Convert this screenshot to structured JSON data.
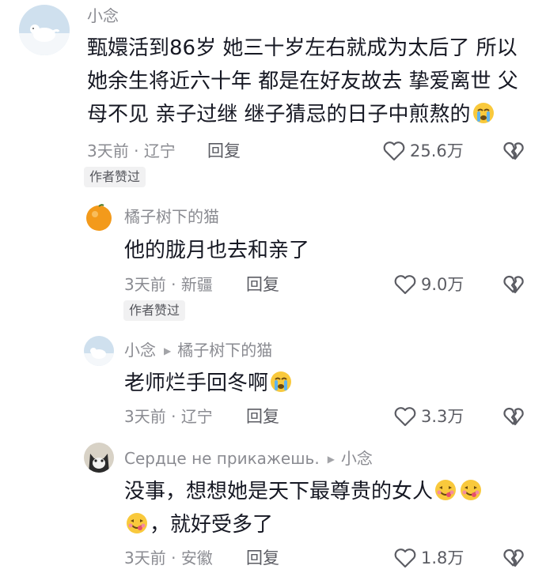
{
  "comments": [
    {
      "author": "小念",
      "reply_to": "",
      "lines": [
        "甄嬛活到86岁 她三十岁左右就成为太后了 所以",
        "她余生将近六十年 都是在好友故去 挚爱离世 父",
        "母不见 亲子过继 继子猜忌的日子中煎熬的"
      ],
      "time": "3天前",
      "location": "辽宁",
      "reply_label": "回复",
      "likes": "25.6万",
      "badge": "作者赞过",
      "avatar": "white-dog-avatar"
    },
    {
      "author": "橘子树下的猫",
      "reply_to": "",
      "lines": [
        "他的胧月也去和亲了"
      ],
      "time": "3天前",
      "location": "新疆",
      "reply_label": "回复",
      "likes": "9.0万",
      "badge": "作者赞过",
      "avatar": "orange-avatar"
    },
    {
      "author": "小念",
      "reply_to": "橘子树下的猫",
      "lines": [
        "老师烂手回冬啊"
      ],
      "time": "3天前",
      "location": "辽宁",
      "reply_label": "回复",
      "likes": "3.3万",
      "badge": "",
      "avatar": "white-dog-avatar"
    },
    {
      "author": "Сердце не прикажешь.",
      "reply_to": "小念",
      "lines": [
        "没事，想想她是天下最尊贵的女人",
        "，就好受多了"
      ],
      "time": "3天前",
      "location": "安徽",
      "reply_label": "回复",
      "likes": "1.8万",
      "badge": "",
      "avatar": "cat-avatar"
    }
  ],
  "dot": "·",
  "colors": {
    "text": "#161823",
    "muted": "#8a8b91",
    "badge_bg": "#f1f1f2"
  }
}
